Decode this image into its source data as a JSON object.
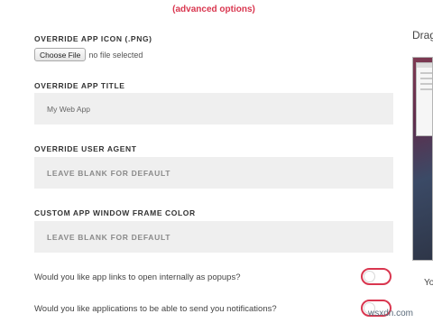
{
  "advanced_link": "(advanced options)",
  "icon_section": {
    "label": "OVERRIDE APP ICON (.PNG)",
    "button_label": "Choose File",
    "file_status": "no file selected"
  },
  "title_section": {
    "label": "OVERRIDE APP TITLE",
    "value": "My Web App"
  },
  "agent_section": {
    "label": "OVERRIDE USER AGENT",
    "placeholder": "LEAVE BLANK FOR DEFAULT"
  },
  "color_section": {
    "label": "CUSTOM APP WINDOW FRAME COLOR",
    "placeholder": "LEAVE BLANK FOR DEFAULT"
  },
  "popups_question": "Would you like app links to open internally as popups?",
  "notifications_question": "Would you like applications to be able to send you notifications?",
  "toggles": {
    "popups_on": false,
    "notifications_on": false
  },
  "right_panel": {
    "heading": "Drag",
    "caption": "Yo"
  },
  "watermark": "wsxdn.com",
  "colors": {
    "accent": "#d9364f",
    "field_bg": "#efefef"
  }
}
